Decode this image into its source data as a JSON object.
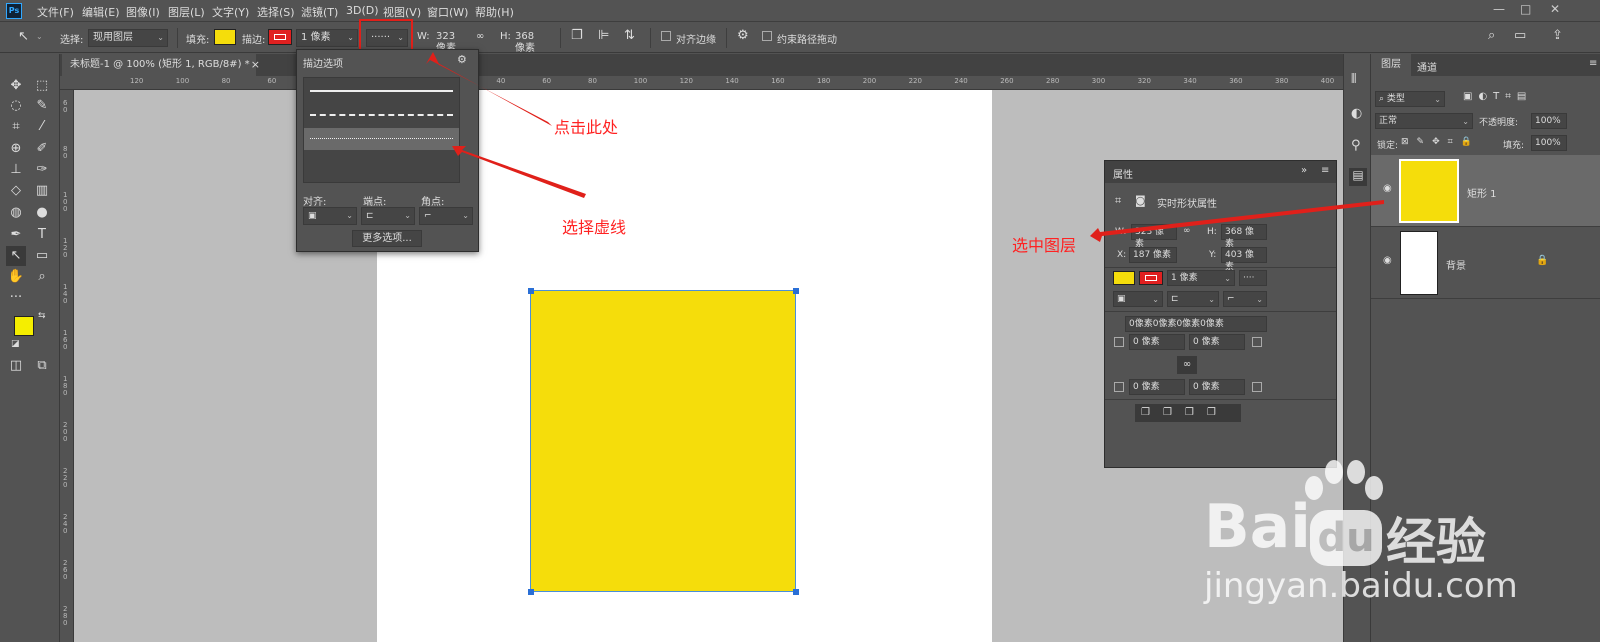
{
  "menubar": {
    "logo": "Ps",
    "items": [
      "文件(F)",
      "编辑(E)",
      "图像(I)",
      "图层(L)",
      "文字(Y)",
      "选择(S)",
      "滤镜(T)",
      "3D(D)",
      "视图(V)",
      "窗口(W)",
      "帮助(H)"
    ],
    "window_buttons": [
      "—",
      "□",
      "✕"
    ]
  },
  "options": {
    "select_label": "选择:",
    "select_value": "现用图层",
    "fill_label": "填充:",
    "fill_color": "#f5dd0b",
    "stroke_label": "描边:",
    "stroke_color": "#e02020",
    "stroke_width": "1 像素",
    "dash_style": "······",
    "w_label": "W:",
    "w_value": "323 像素",
    "link_icon": "∞",
    "h_label": "H:",
    "h_value": "368 像素",
    "align_edges_label": "对齐边缘",
    "constrain_label": "约束路径拖动"
  },
  "document": {
    "tab_title": "未标题-1 @ 100% (矩形 1, RGB/8#) *",
    "close": "×"
  },
  "rulers": {
    "h_ticks": [
      "120",
      "100",
      "80",
      "60",
      "40",
      "20",
      "0",
      "20",
      "40",
      "60",
      "80",
      "100",
      "120",
      "140",
      "160",
      "180",
      "200",
      "220",
      "240",
      "260",
      "280",
      "300",
      "320",
      "340",
      "360",
      "380",
      "400",
      "420"
    ],
    "v_ticks": [
      "60",
      "80",
      "100",
      "120",
      "140",
      "160",
      "180",
      "200",
      "220",
      "240",
      "260",
      "280"
    ]
  },
  "stroke_options": {
    "title": "描边选项",
    "align_label": "对齐:",
    "caps_label": "端点:",
    "corners_label": "角点:",
    "more_button": "更多选项..."
  },
  "properties": {
    "tab": "属性",
    "header": "实时形状属性",
    "w_label": "W:",
    "w_value": "323 像素",
    "h_label": "H:",
    "h_value": "368 像素",
    "x_label": "X:",
    "x_value": "187 像素",
    "y_label": "Y:",
    "y_value": "403 像素",
    "stroke_width": "1 像素",
    "dash": "····",
    "radius_all": "0像素0像素0像素0像素",
    "r1": "0 像素",
    "r2": "0 像素",
    "r3": "0 像素",
    "r4": "0 像素"
  },
  "layers_panel": {
    "tabs": [
      "图层",
      "通道"
    ],
    "filter": "类型",
    "blend": "正常",
    "opacity_label": "不透明度:",
    "opacity": "100%",
    "lock_label": "锁定:",
    "fill_label": "填充:",
    "fill": "100%",
    "layers": [
      {
        "name": "矩形 1",
        "color": "#f5dd0b",
        "selected": true
      },
      {
        "name": "背景",
        "color": "#ffffff",
        "selected": false
      }
    ]
  },
  "colors": {
    "foreground": "#f5ee00",
    "background": "#ffffff",
    "accent_red": "#e0201a"
  },
  "annotations": {
    "click_here": "点击此处",
    "select_dash": "选择虚线",
    "select_layer": "选中图层"
  },
  "watermark": {
    "brand_latin": "Bai",
    "brand_du": "du",
    "brand_cn": "经验",
    "url": "jingyan.baidu.com"
  }
}
